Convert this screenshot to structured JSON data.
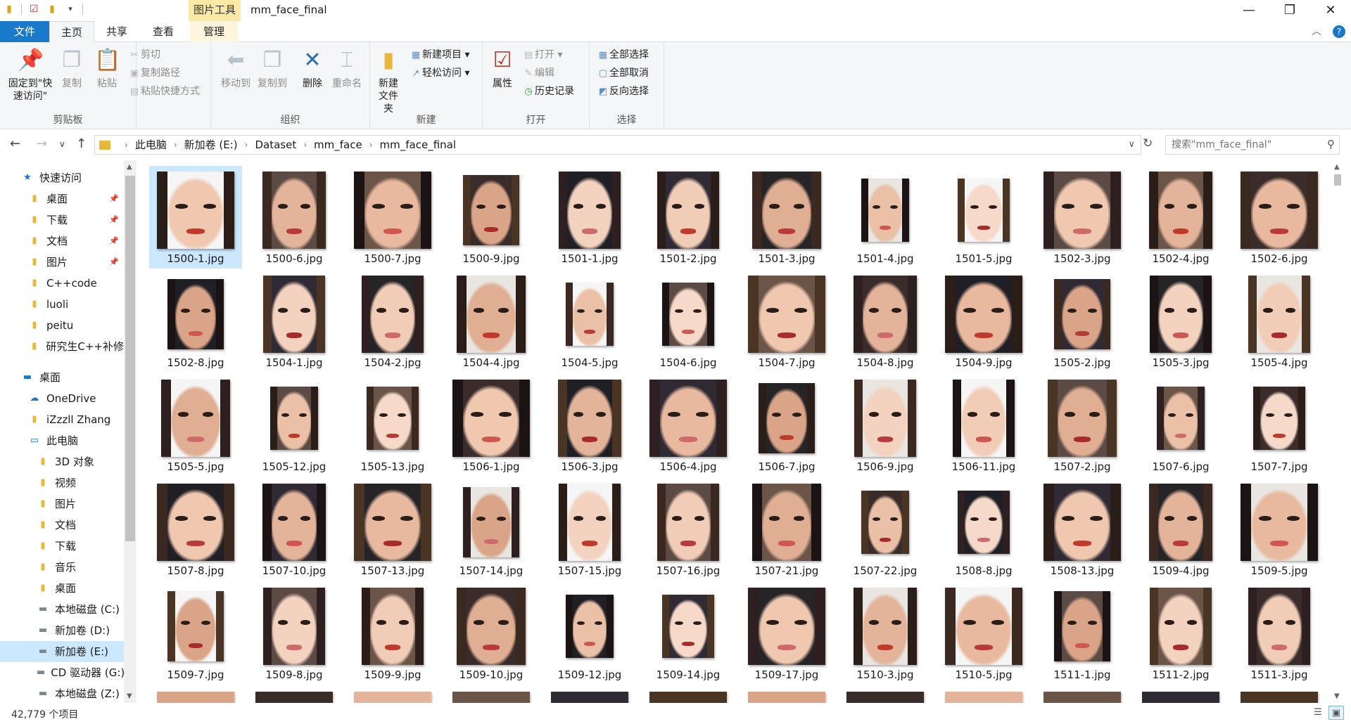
{
  "window": {
    "title": "mm_face_final",
    "picture_tools_tab": "图片工具",
    "minimize": "—",
    "maximize": "❐",
    "close": "✕"
  },
  "tabs": {
    "file": "文件",
    "home": "主页",
    "share": "共享",
    "view": "查看",
    "manage": "管理"
  },
  "ribbon": {
    "clipboard": {
      "label": "剪贴板",
      "pin": "固定到\"快速访问\"",
      "copy": "复制",
      "paste": "粘贴",
      "cut": "剪切",
      "copy_path": "复制路径",
      "paste_shortcut": "粘贴快捷方式"
    },
    "organize": {
      "label": "组织",
      "move_to": "移动到",
      "copy_to": "复制到",
      "delete": "删除",
      "rename": "重命名"
    },
    "new": {
      "label": "新建",
      "new_folder": "新建\n文件夹",
      "new_item": "新建项目",
      "easy_access": "轻松访问"
    },
    "open": {
      "label": "打开",
      "properties": "属性",
      "open": "打开",
      "edit": "编辑",
      "history": "历史记录"
    },
    "select": {
      "label": "选择",
      "select_all": "全部选择",
      "select_none": "全部取消",
      "invert": "反向选择"
    }
  },
  "address": {
    "crumbs": [
      "此电脑",
      "新加卷 (E:)",
      "Dataset",
      "mm_face",
      "mm_face_final"
    ],
    "search_placeholder": "搜索\"mm_face_final\""
  },
  "nav": {
    "quick_access": "快速访问",
    "items": [
      {
        "label": "桌面",
        "pinned": true
      },
      {
        "label": "下载",
        "pinned": true
      },
      {
        "label": "文档",
        "pinned": true
      },
      {
        "label": "图片",
        "pinned": true
      },
      {
        "label": "C++code"
      },
      {
        "label": "luoli"
      },
      {
        "label": "peitu"
      },
      {
        "label": "研究生C++补修"
      }
    ],
    "desktop": "桌面",
    "onedrive": "OneDrive",
    "user": "iZzzll Zhang",
    "this_pc": "此电脑",
    "pc_items": [
      {
        "label": "3D 对象"
      },
      {
        "label": "视频"
      },
      {
        "label": "图片"
      },
      {
        "label": "文档"
      },
      {
        "label": "下载"
      },
      {
        "label": "音乐"
      },
      {
        "label": "桌面"
      },
      {
        "label": "本地磁盘 (C:)"
      },
      {
        "label": "新加卷 (D:)"
      },
      {
        "label": "新加卷 (E:)",
        "selected": true
      },
      {
        "label": "CD 驱动器 (G:)"
      },
      {
        "label": "本地磁盘 (Z:)"
      }
    ]
  },
  "files": [
    "1500-1.jpg",
    "1500-6.jpg",
    "1500-7.jpg",
    "1500-9.jpg",
    "1501-1.jpg",
    "1501-2.jpg",
    "1501-3.jpg",
    "1501-4.jpg",
    "1501-5.jpg",
    "1502-3.jpg",
    "1502-4.jpg",
    "1502-6.jpg",
    "1502-8.jpg",
    "1504-1.jpg",
    "1504-2.jpg",
    "1504-4.jpg",
    "1504-5.jpg",
    "1504-6.jpg",
    "1504-7.jpg",
    "1504-8.jpg",
    "1504-9.jpg",
    "1505-2.jpg",
    "1505-3.jpg",
    "1505-4.jpg",
    "1505-5.jpg",
    "1505-12.jpg",
    "1505-13.jpg",
    "1506-1.jpg",
    "1506-3.jpg",
    "1506-4.jpg",
    "1506-7.jpg",
    "1506-9.jpg",
    "1506-11.jpg",
    "1507-2.jpg",
    "1507-6.jpg",
    "1507-7.jpg",
    "1507-8.jpg",
    "1507-10.jpg",
    "1507-13.jpg",
    "1507-14.jpg",
    "1507-15.jpg",
    "1507-16.jpg",
    "1507-21.jpg",
    "1507-22.jpg",
    "1508-8.jpg",
    "1508-13.jpg",
    "1509-4.jpg",
    "1509-5.jpg",
    "1509-7.jpg",
    "1509-8.jpg",
    "1509-9.jpg",
    "1509-10.jpg",
    "1509-12.jpg",
    "1509-14.jpg",
    "1509-17.jpg",
    "1510-3.jpg",
    "1510-5.jpg",
    "1511-1.jpg",
    "1511-2.jpg",
    "1511-3.jpg"
  ],
  "selected_file": "1500-1.jpg",
  "status": {
    "count": "42,779 个项目"
  },
  "colors": {
    "accent": "#1979ca",
    "selection": "#cce8ff",
    "picture_tools": "#fbe9a6"
  }
}
